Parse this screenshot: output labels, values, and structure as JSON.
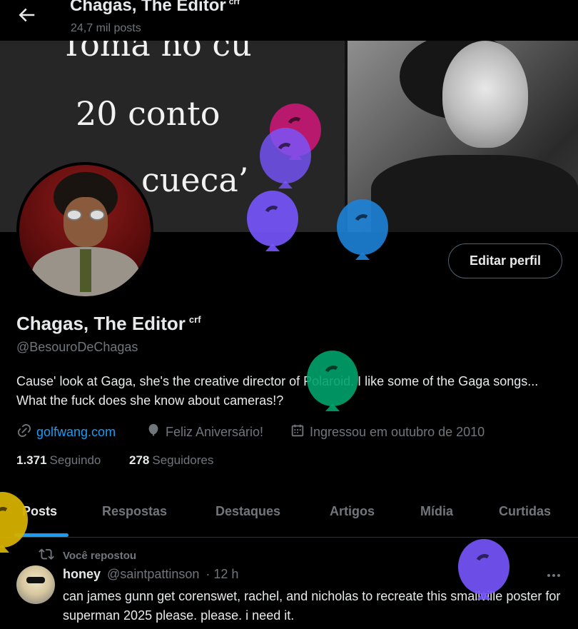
{
  "header": {
    "name": "Chagas, The Editor",
    "badge": "crf",
    "posts_count": "24,7 mil posts"
  },
  "banner": {
    "lines": [
      "Toma no cu",
      "20 conto",
      "cueca’"
    ]
  },
  "profile": {
    "edit_button": "Editar perfil",
    "name": "Chagas, The Editor",
    "badge": "crf",
    "handle": "@BesouroDeChagas",
    "bio": "Cause' look at Gaga, she's the creative director of Polaroid. I like some of the Gaga songs... What the fuck does she know about cameras!?",
    "link": "golfwang.com",
    "birthday": "Feliz Aniversário!",
    "joined": "Ingressou em outubro de 2010",
    "following_count": "1.371",
    "following_label": "Seguindo",
    "followers_count": "278",
    "followers_label": "Seguidores"
  },
  "tabs": [
    {
      "label": "Posts",
      "active": true
    },
    {
      "label": "Respostas"
    },
    {
      "label": "Destaques"
    },
    {
      "label": "Artigos"
    },
    {
      "label": "Mídia"
    },
    {
      "label": "Curtidas"
    }
  ],
  "post": {
    "repost_label": "Você repostou",
    "user": "honey",
    "handle": "@saintpattinson",
    "time": "· 12 h",
    "text": "can james gunn get corenswet, rachel, and nicholas to recreate this smallville poster for superman 2025 please. please. i need it."
  },
  "colors": {
    "accent": "#1d9bf0",
    "background": "#000000",
    "secondary_text": "#71767b",
    "balloons": [
      "#d4177a",
      "#7856ff",
      "#1d82d8",
      "#00a36c",
      "#d4b000"
    ]
  },
  "icons": {
    "back": "arrow-left-icon",
    "link": "link-icon",
    "birthday": "balloon-icon",
    "joined": "calendar-icon",
    "repost": "repost-icon",
    "more": "more-icon"
  }
}
